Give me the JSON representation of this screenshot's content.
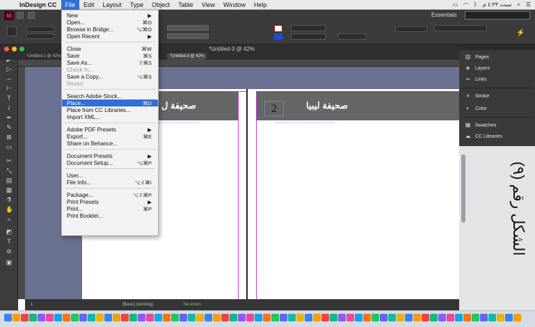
{
  "menubar": {
    "app_name": "InDesign CC",
    "items": [
      "File",
      "Edit",
      "Layout",
      "Type",
      "Object",
      "Table",
      "View",
      "Window",
      "Help"
    ],
    "clock": "سبت ٤:٣٣ م",
    "status_icons": [
      "battery-icon",
      "wifi-icon",
      "bluetooth-icon",
      "search-icon",
      "list-icon"
    ]
  },
  "control_panel": {
    "workspace": "Essentials",
    "search_placeholder": "",
    "fields": [
      "4.233 mm",
      "4.233 mm",
      "0 pt",
      "100%"
    ]
  },
  "document": {
    "window_title": "*Untitled-3 @ 42%",
    "tabs": [
      "*Untitled-1 @ 42%",
      "*Untitled-3 @ 42%"
    ],
    "page_header_right": "صحيفة ليبيا",
    "page_header_left": "صحيفة ل",
    "page_number": "2"
  },
  "status_bar": {
    "page": "1",
    "style": "[Basic] (working)",
    "errors": "No errors"
  },
  "panels": {
    "items": [
      {
        "icon": "pages-icon",
        "label": "Pages"
      },
      {
        "icon": "layers-icon",
        "label": "Layers"
      },
      {
        "icon": "links-icon",
        "label": "Links"
      },
      {
        "icon": "stroke-icon",
        "label": "Stroke"
      },
      {
        "icon": "color-icon",
        "label": "Color"
      },
      {
        "icon": "swatches-icon",
        "label": "Swatches"
      },
      {
        "icon": "cc-libraries-icon",
        "label": "CC Libraries"
      }
    ]
  },
  "side_caption": "الشكل رقم (٩)",
  "file_menu": {
    "items": [
      {
        "label": "New",
        "shortcut": "▶"
      },
      {
        "label": "Open...",
        "shortcut": "⌘O"
      },
      {
        "label": "Browse in Bridge...",
        "shortcut": "⌥⌘O"
      },
      {
        "label": "Open Recent",
        "shortcut": "▶"
      },
      {
        "label": "Close",
        "shortcut": "⌘W"
      },
      {
        "label": "Save",
        "shortcut": "⌘S"
      },
      {
        "label": "Save As...",
        "shortcut": "⇧⌘S"
      },
      {
        "label": "Check In...",
        "shortcut": "",
        "disabled": true
      },
      {
        "label": "Save a Copy...",
        "shortcut": "⌥⌘S"
      },
      {
        "label": "Revert",
        "shortcut": "",
        "disabled": true
      },
      {
        "label": "Search Adobe Stock...",
        "shortcut": ""
      },
      {
        "label": "Place...",
        "shortcut": "⌘D",
        "highlighted": true
      },
      {
        "label": "Place from CC Libraries...",
        "shortcut": ""
      },
      {
        "label": "Import XML...",
        "shortcut": ""
      },
      {
        "label": "Adobe PDF Presets",
        "shortcut": "▶"
      },
      {
        "label": "Export...",
        "shortcut": "⌘E"
      },
      {
        "label": "Share on Behance...",
        "shortcut": ""
      },
      {
        "label": "Document Presets",
        "shortcut": "▶"
      },
      {
        "label": "Document Setup...",
        "shortcut": "⌥⌘P"
      },
      {
        "label": "User...",
        "shortcut": ""
      },
      {
        "label": "File Info...",
        "shortcut": "⌥⇧⌘I"
      },
      {
        "label": "Package...",
        "shortcut": "⌥⇧⌘P"
      },
      {
        "label": "Print Presets",
        "shortcut": "▶"
      },
      {
        "label": "Print...",
        "shortcut": "⌘P"
      },
      {
        "label": "Print Booklet...",
        "shortcut": ""
      }
    ]
  }
}
